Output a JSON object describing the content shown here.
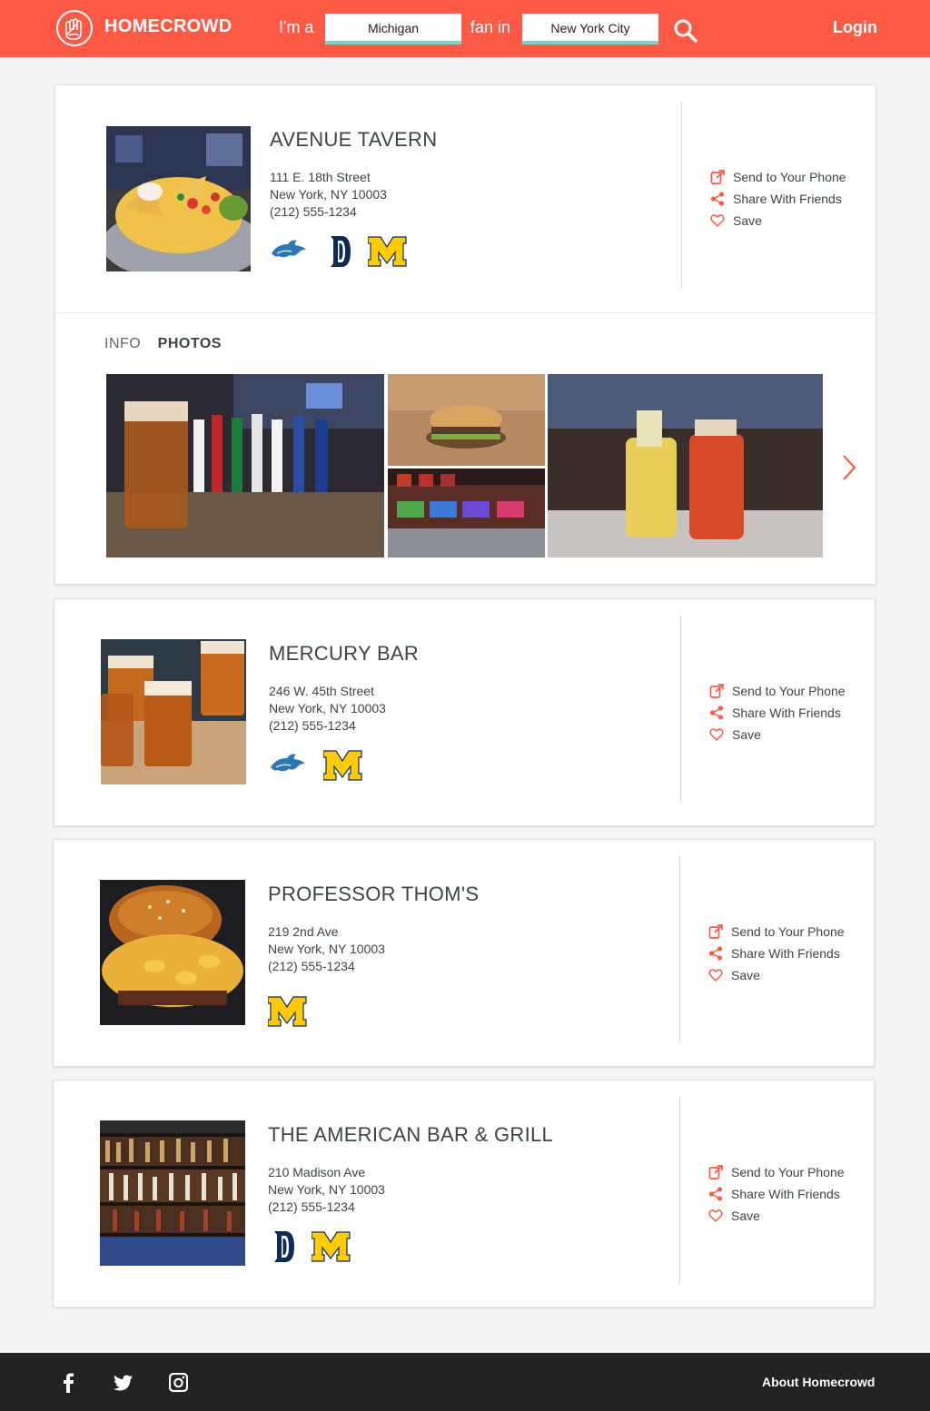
{
  "header": {
    "brand": "HOMECROWD",
    "prefix": "I'm a",
    "team_value": "Michigan",
    "middle": "fan in",
    "city_value": "New York City",
    "login": "Login"
  },
  "actions": {
    "send": "Send to Your Phone",
    "share": "Share With Friends",
    "save": "Save"
  },
  "tabs": {
    "info": "INFO",
    "photos": "PHOTOS"
  },
  "venues": [
    {
      "name": "AVENUE TAVERN",
      "street": "111 E. 18th Street",
      "city": "New York, NY 10003",
      "phone": "(212) 555-1234",
      "logos": [
        "lions-logo",
        "tigers-logo",
        "michigan-logo"
      ]
    },
    {
      "name": "MERCURY BAR",
      "street": "246 W. 45th Street",
      "city": "New York, NY 10003",
      "phone": "(212) 555-1234",
      "logos": [
        "lions-logo",
        "michigan-logo"
      ]
    },
    {
      "name": "PROFESSOR THOM'S",
      "street": "219 2nd Ave",
      "city": "New York, NY 10003",
      "phone": "(212) 555-1234",
      "logos": [
        "michigan-logo"
      ]
    },
    {
      "name": "THE AMERICAN BAR & GRILL",
      "street": "210 Madison Ave",
      "city": "New York, NY 10003",
      "phone": "(212) 555-1234",
      "logos": [
        "tigers-logo",
        "michigan-logo"
      ]
    }
  ],
  "footer": {
    "about": "About Homecrowd"
  },
  "colors": {
    "brand": "#ff5a45",
    "accent": "#7fd2cc",
    "text": "#3d4448",
    "lions": "#2a78b8",
    "tigers": "#0c2c56",
    "michigan": "#ffcb05"
  }
}
